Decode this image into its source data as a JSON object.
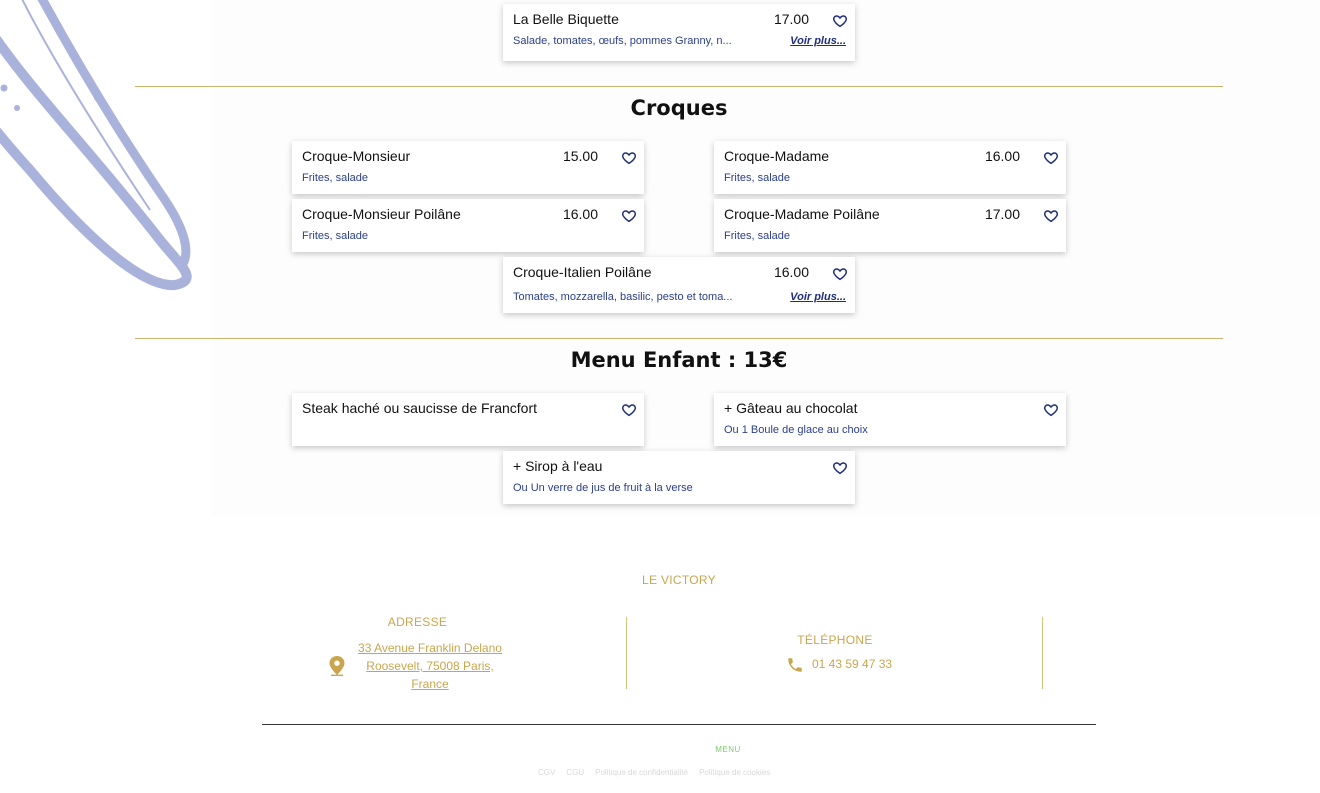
{
  "colors": {
    "accent_gold": "#c9a64e",
    "desc_blue": "#2a3f8e",
    "cucumber": "#a9b2db"
  },
  "top_card": {
    "name": "La Belle Biquette",
    "price": "17.00",
    "desc": "Salade, tomates, œufs, pommes Granny, n...",
    "more": "Voir plus..."
  },
  "croques": {
    "title": "Croques",
    "items": [
      {
        "name": "Croque-Monsieur",
        "price": "15.00",
        "desc": "Frites, salade"
      },
      {
        "name": "Croque-Madame",
        "price": "16.00",
        "desc": "Frites, salade"
      },
      {
        "name": "Croque-Monsieur Poilâne",
        "price": "16.00",
        "desc": "Frites, salade"
      },
      {
        "name": "Croque-Madame Poilâne",
        "price": "17.00",
        "desc": "Frites, salade"
      },
      {
        "name": "Croque-Italien Poilâne",
        "price": "16.00",
        "desc": "Tomates, mozzarella, basilic, pesto et toma...",
        "more": "Voir plus..."
      }
    ]
  },
  "enfant": {
    "title": "Menu Enfant : 13€",
    "items": [
      {
        "name": "Steak haché ou saucisse de Francfort",
        "desc": ""
      },
      {
        "name": "+ Gâteau au chocolat",
        "desc": "Ou 1 Boule de glace au choix"
      },
      {
        "name": "+ Sirop à l'eau",
        "desc": "Ou Un verre de jus de fruit à la verse"
      }
    ]
  },
  "footer": {
    "brand": "LE VICTORY",
    "address_title": "ADRESSE",
    "address_line1": "33 Avenue Franklin Delano",
    "address_line2": "Roosevelt, 75008 Paris,",
    "address_line3": "France",
    "phone_title": "TÉLÉPHONE",
    "phone": "01 43 59 47 33",
    "menu_link": "MENU",
    "legal": [
      "CGV",
      "CGU",
      "Politique de confidentialité",
      "Politique de cookies"
    ]
  },
  "icons": {
    "favorite": "heart-outline-icon",
    "location": "map-pin-icon",
    "phone": "phone-icon"
  }
}
